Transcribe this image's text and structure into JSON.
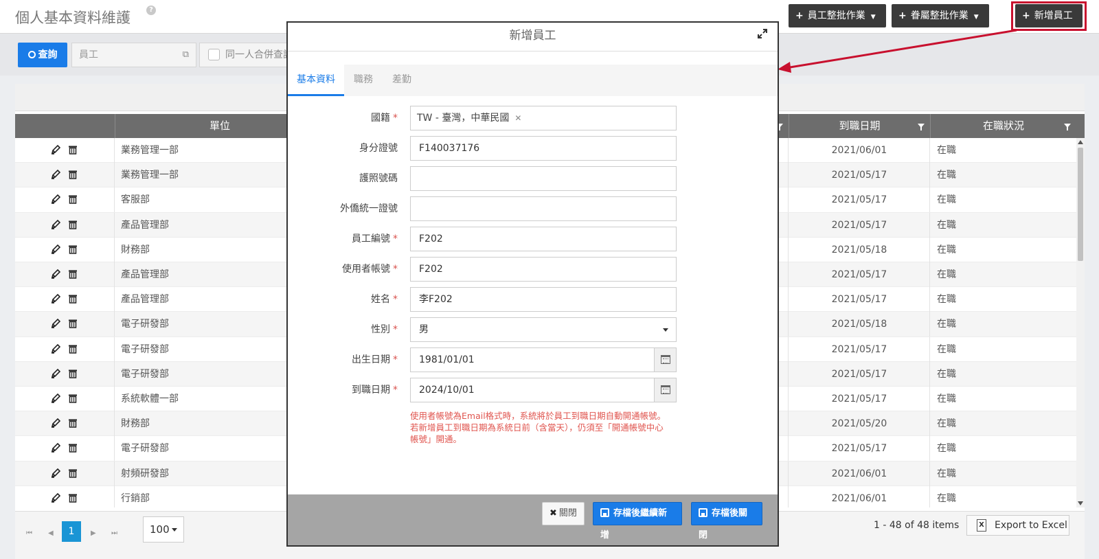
{
  "header": {
    "title": "個人基本資料維護",
    "help_icon": "question-circle-icon",
    "buttons": {
      "employee_batch": "員工整批作業",
      "dependent_batch": "眷屬整批作業",
      "add_employee": "新增員工"
    }
  },
  "toolbar": {
    "query_label": "查詢",
    "employee_placeholder": "員工",
    "merge_label": "同一人合併查詢"
  },
  "grid": {
    "columns": {
      "unit": "單位",
      "start_date": "到職日期",
      "status": "在職狀況"
    },
    "rows": [
      {
        "unit": "業務管理一部",
        "start_date": "2021/06/01",
        "status": "在職"
      },
      {
        "unit": "業務管理一部",
        "start_date": "2021/05/17",
        "status": "在職"
      },
      {
        "unit": "客服部",
        "start_date": "2021/05/17",
        "status": "在職"
      },
      {
        "unit": "產品管理部",
        "start_date": "2021/05/17",
        "status": "在職"
      },
      {
        "unit": "財務部",
        "start_date": "2021/05/18",
        "status": "在職"
      },
      {
        "unit": "產品管理部",
        "start_date": "2021/05/17",
        "status": "在職"
      },
      {
        "unit": "產品管理部",
        "start_date": "2021/05/17",
        "status": "在職"
      },
      {
        "unit": "電子研發部",
        "start_date": "2021/05/18",
        "status": "在職"
      },
      {
        "unit": "電子研發部",
        "start_date": "2021/05/17",
        "status": "在職"
      },
      {
        "unit": "電子研發部",
        "start_date": "2021/05/17",
        "status": "在職"
      },
      {
        "unit": "系統軟體一部",
        "start_date": "2021/05/17",
        "status": "在職"
      },
      {
        "unit": "財務部",
        "start_date": "2021/05/20",
        "status": "在職"
      },
      {
        "unit": "電子研發部",
        "start_date": "2021/05/17",
        "status": "在職"
      },
      {
        "unit": "射頻研發部",
        "start_date": "2021/06/01",
        "status": "在職"
      },
      {
        "unit": "行銷部",
        "start_date": "2021/06/01",
        "status": "在職"
      }
    ]
  },
  "pager": {
    "current_page": "1",
    "page_size": "100",
    "info": "1 - 48 of 48 items",
    "export_label": "Export to Excel"
  },
  "modal": {
    "title": "新增員工",
    "tabs": [
      "基本資料",
      "職務",
      "差勤"
    ],
    "fields": {
      "nationality": {
        "label": "國籍",
        "value": "TW - 臺灣，中華民國"
      },
      "id_number": {
        "label": "身分證號",
        "value": "F140037176"
      },
      "passport": {
        "label": "護照號碼",
        "value": ""
      },
      "resident_id": {
        "label": "外僑統一證號",
        "value": ""
      },
      "employee_no": {
        "label": "員工編號",
        "value": "F202"
      },
      "account": {
        "label": "使用者帳號",
        "value": "F202"
      },
      "name": {
        "label": "姓名",
        "value": "李F202"
      },
      "gender": {
        "label": "性別",
        "value": "男"
      },
      "birth_date": {
        "label": "出生日期",
        "value": "1981/01/01"
      },
      "start_date": {
        "label": "到職日期",
        "value": "2024/10/01"
      }
    },
    "note_lines": [
      "使用者帳號為Email格式時，系統將於員工到職日期自動開通帳號。",
      "若新增員工到職日期為系統日前（含當天），仍須至「開通帳號中心",
      "帳號」開通。"
    ],
    "buttons": {
      "close": "關閉",
      "save_continue": "存檔後繼續新增",
      "save_close": "存檔後關閉"
    }
  },
  "colors": {
    "primary": "#1a7ce8",
    "dark_button": "#3a3a3a",
    "highlight": "#c8102e",
    "required": "#d9534f"
  }
}
